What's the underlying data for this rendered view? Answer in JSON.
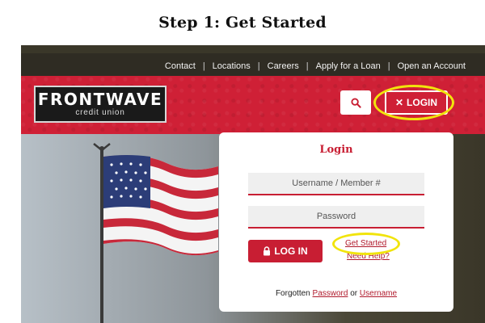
{
  "step_title": "Step 1: Get Started",
  "top_nav": {
    "links": [
      "Contact",
      "Locations",
      "Careers",
      "Apply for a Loan",
      "Open an Account"
    ],
    "separator": "|"
  },
  "header": {
    "logo_name": "FRONTWAVE",
    "logo_sub": "credit union",
    "login_button": "LOGIN",
    "login_icon_glyph": "✕"
  },
  "login_panel": {
    "title": "Login",
    "username_placeholder": "Username / Member #",
    "password_placeholder": "Password",
    "login_button": "LOG IN",
    "get_started": "Get Started",
    "need_help": "Need Help?",
    "forgot_prefix": "Forgotten",
    "forgot_password": "Password",
    "forgot_or": "or",
    "forgot_username": "Username"
  },
  "colors": {
    "brand_red": "#cf2036",
    "highlight_yellow": "#f1e40c",
    "topbar": "#2f2c23"
  }
}
